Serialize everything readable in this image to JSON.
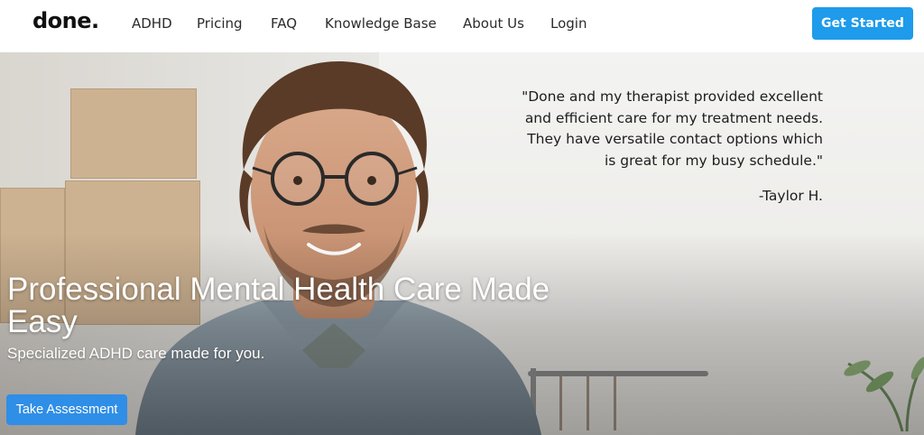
{
  "header": {
    "logo": "done.",
    "nav": [
      {
        "label": "ADHD"
      },
      {
        "label": "Pricing"
      },
      {
        "label": "FAQ"
      },
      {
        "label": "Knowledge Base"
      },
      {
        "label": "About Us"
      },
      {
        "label": "Login"
      }
    ],
    "cta_label": "Get Started"
  },
  "hero": {
    "testimonial": {
      "lines": [
        "\"Done and my therapist provided excellent",
        "and efficient care for my treatment needs.",
        "They have versatile contact options which",
        "is great for my busy schedule.\""
      ],
      "author": "-Taylor H."
    },
    "headline_line1": "Professional Mental Health Care Made",
    "headline_line2": "Easy",
    "subheadline": "Specialized ADHD care made for you.",
    "button_label": "Take Assessment"
  },
  "colors": {
    "accent": "#1e9bea",
    "button": "#2f8ee6",
    "text_dark": "#1d1d1d"
  }
}
